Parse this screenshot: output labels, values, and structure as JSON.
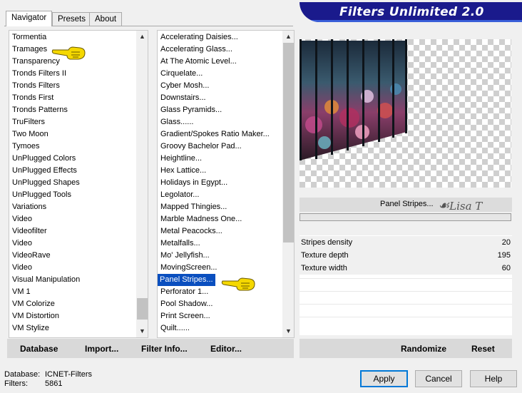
{
  "tabs": [
    {
      "label": "Navigator",
      "active": true
    },
    {
      "label": "Presets",
      "active": false
    },
    {
      "label": "About",
      "active": false
    }
  ],
  "banner": {
    "title": "Filters Unlimited 2.0"
  },
  "categories": [
    "Tormentia",
    "Tramages",
    "Transparency",
    "Tronds Filters II",
    "Tronds Filters",
    "Tronds First",
    "Tronds Patterns",
    "TruFilters",
    "Two Moon",
    "Tymoes",
    "UnPlugged Colors",
    "UnPlugged Effects",
    "UnPlugged Shapes",
    "UnPlugged Tools",
    "Variations",
    "Video",
    "Videofilter",
    "Video",
    "VideoRave",
    "Video",
    "Visual Manipulation",
    "VM 1",
    "VM Colorize",
    "VM Distortion",
    "VM Stylize"
  ],
  "filters": [
    "Accelerating Daisies...",
    "Accelerating Glass...",
    "At The Atomic Level...",
    "Cirquelate...",
    "Cyber Mosh...",
    "Downstairs...",
    "Glass Pyramids...",
    "Glass......",
    "Gradient/Spokes Ratio Maker...",
    "Groovy Bachelor Pad...",
    "Heightline...",
    "Hex Lattice...",
    "Holidays in Egypt...",
    "Legolator...",
    "Mapped Thingies...",
    "Marble Madness One...",
    "Metal Peacocks...",
    "Metalfalls...",
    "Mo' Jellyfish...",
    "MovingScreen...",
    "Panel Stripes...",
    "Perforator 1...",
    "Pool Shadow...",
    "Print Screen...",
    "Quilt......"
  ],
  "selected_filter_index": 20,
  "filter_name_display": "Panel Stripes...",
  "watermark": "Lisa T",
  "params": [
    {
      "label": "Stripes density",
      "value": "20"
    },
    {
      "label": "Texture depth",
      "value": "195"
    },
    {
      "label": "Texture width",
      "value": "60"
    }
  ],
  "bottom_left_buttons": [
    "Database",
    "Import...",
    "Filter Info...",
    "Editor..."
  ],
  "bottom_right_buttons": [
    "Randomize",
    "Reset"
  ],
  "status": {
    "database_label": "Database:",
    "database_value": "ICNET-Filters",
    "filters_label": "Filters:",
    "filters_value": "5861"
  },
  "dialog_buttons": {
    "apply": "Apply",
    "cancel": "Cancel",
    "help": "Help"
  },
  "colors": {
    "banner": "#1a1a8c",
    "selection": "#0a4fbf",
    "pointer_hand": "#f5d800"
  }
}
